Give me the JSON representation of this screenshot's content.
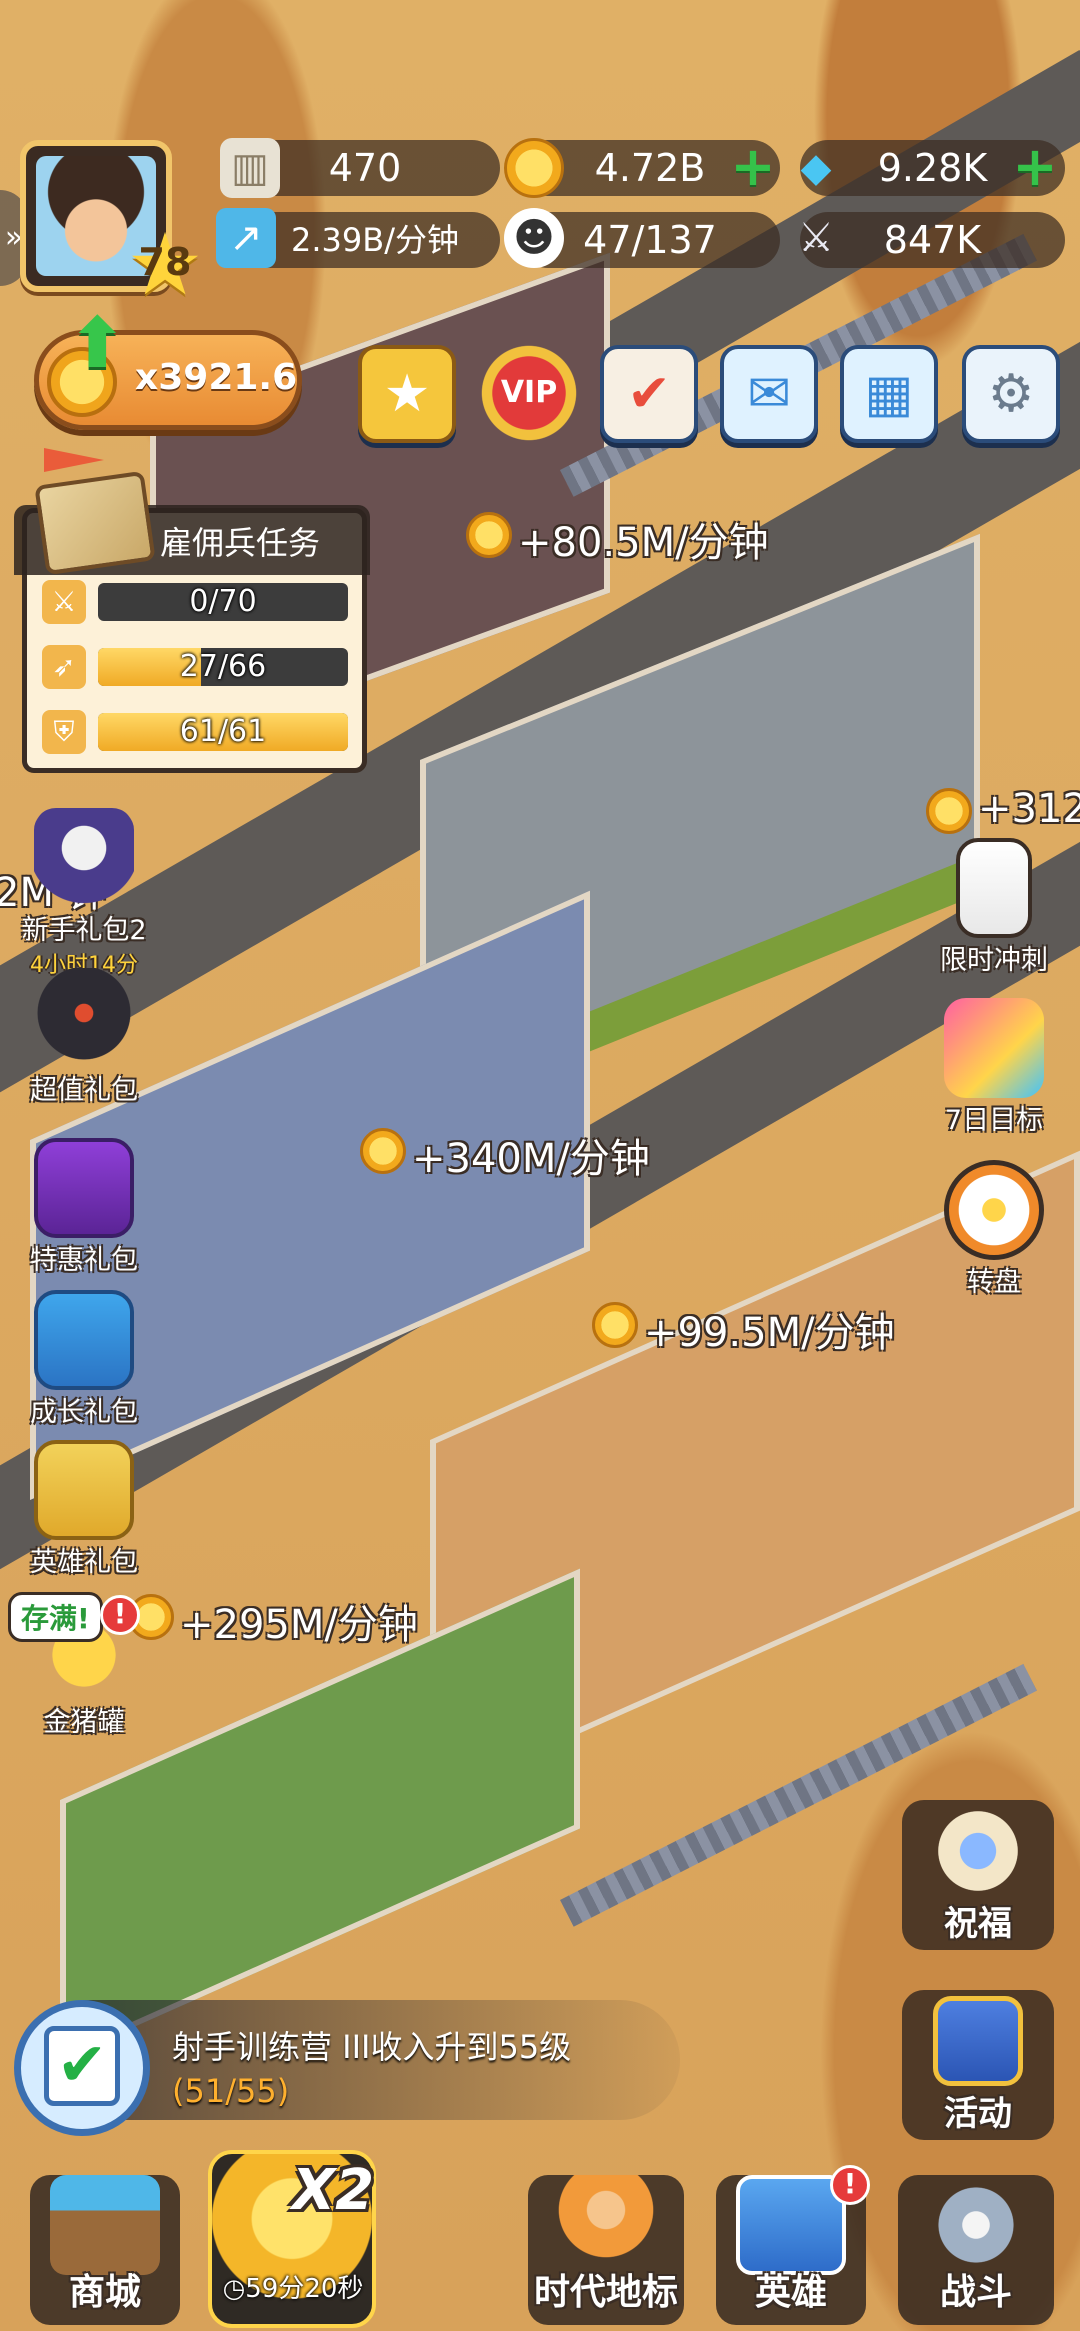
{
  "player": {
    "level": "78"
  },
  "resources": {
    "relic": "470",
    "coins": "4.72B",
    "gems": "9.28K",
    "income_rate": "2.39B/分钟",
    "population": "47/137",
    "power": "847K"
  },
  "income_multiplier": "x3921.6",
  "top_buttons": [
    "star-pass-icon",
    "vip-icon",
    "calendar-check-icon",
    "mail-icon",
    "growth-chart-icon",
    "gear-icon"
  ],
  "mercenary_task": {
    "title": "雇佣兵任务",
    "rows": [
      {
        "icon": "sword-icon",
        "text": "0/70",
        "progress": 0.0
      },
      {
        "icon": "bow-icon",
        "text": "27/66",
        "progress": 0.41
      },
      {
        "icon": "shield-icon",
        "text": "61/61",
        "progress": 1.0
      }
    ]
  },
  "income_floats": [
    "+80.5M/分钟",
    "+312",
    "+340M/分钟",
    "+99.5M/分钟",
    "+295M/分钟",
    "2M  钟"
  ],
  "left_side": {
    "newbie_pack": {
      "label": "新手礼包2",
      "timer": "4小时14分"
    },
    "super_pack": "超值礼包",
    "special_pack": "特惠礼包",
    "growth_pack": "成长礼包",
    "hero_pack": "英雄礼包",
    "piggy_bank": {
      "label": "金猪罐",
      "badge": "存满!"
    }
  },
  "right_side": {
    "limited_sprint": "限时冲刺",
    "seven_day": "7日目标",
    "wheel": "转盘",
    "blessing": "祝福",
    "events": "活动"
  },
  "quest": {
    "text": "射手训练营 III收入升到55级",
    "progress": "(51/55)"
  },
  "bottom_nav": {
    "shop": "商城",
    "x2_label": "X2",
    "x2_timer": "59分20秒",
    "landmark": "时代地标",
    "heroes": "英雄",
    "battle": "战斗"
  },
  "colors": {
    "accent_gold": "#f0aa25",
    "plus_green": "#35c24a",
    "alert_red": "#e63b3b",
    "desert": "#d9a95a"
  }
}
